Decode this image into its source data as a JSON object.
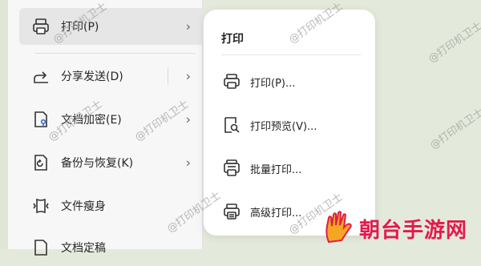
{
  "menu": {
    "items": [
      {
        "label": "打印(P)",
        "icon": "printer-icon",
        "has_submenu": true,
        "active": true
      },
      {
        "label": "分享发送(D)",
        "icon": "share-icon",
        "has_submenu": true
      },
      {
        "label": "文档加密(E)",
        "icon": "document-lock-icon",
        "has_submenu": true
      },
      {
        "label": "备份与恢复(K)",
        "icon": "backup-restore-icon",
        "has_submenu": true
      },
      {
        "label": "文件瘦身",
        "icon": "file-slim-icon",
        "has_submenu": false
      },
      {
        "label": "文档定稿",
        "icon": "document-finalize-icon",
        "has_submenu": false
      }
    ]
  },
  "submenu": {
    "title": "打印",
    "items": [
      {
        "label": "打印(P)...",
        "icon": "printer-icon"
      },
      {
        "label": "打印预览(V)...",
        "icon": "print-preview-icon"
      },
      {
        "label": "批量打印...",
        "icon": "batch-print-icon"
      },
      {
        "label": "高级打印...",
        "icon": "advanced-print-icon"
      }
    ]
  },
  "watermark": "@打印机卫士",
  "brand": {
    "name": "朝台手游网",
    "color": "#e21b4c"
  }
}
